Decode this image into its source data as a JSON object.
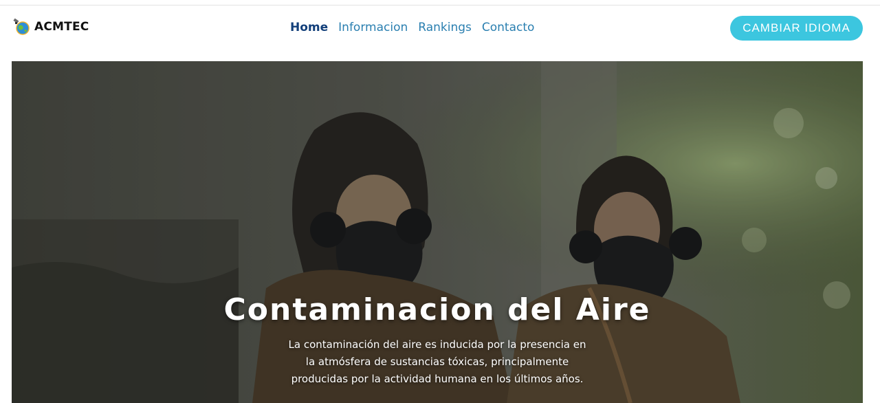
{
  "brand": {
    "name": "ACMTEC",
    "logo_icon": "satellite-globe-icon"
  },
  "nav": {
    "items": [
      {
        "label": "Home",
        "active": true
      },
      {
        "label": "Informacion",
        "active": false
      },
      {
        "label": "Rankings",
        "active": false
      },
      {
        "label": "Contacto",
        "active": false
      }
    ]
  },
  "language_button": {
    "label": "CAMBIAR IDIOMA"
  },
  "hero": {
    "title": "Contaminacion del Aire",
    "text": "La contaminación del aire es inducida por la presencia en la atmósfera de sustancias tóxicas, principalmente producidas por la actividad humana en los últimos años."
  },
  "colors": {
    "accent": "#3cc6df",
    "nav_link": "#2a7fb0",
    "nav_active": "#123f7a"
  }
}
